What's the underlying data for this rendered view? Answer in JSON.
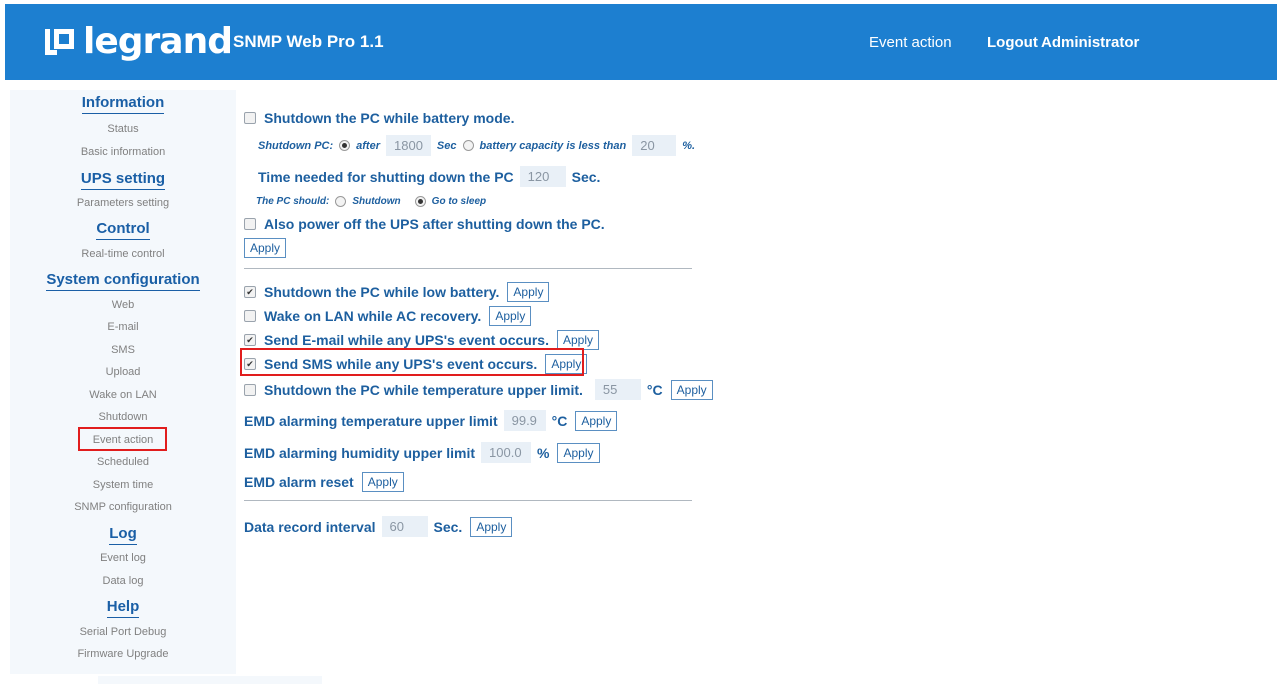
{
  "header": {
    "logo_text": "legrand",
    "app_title": "SNMP Web Pro 1.1",
    "breadcrumb": "Event action",
    "logout_label": "Logout",
    "user_label": "Administrator"
  },
  "sidebar": {
    "sections": [
      {
        "title": "Information",
        "items": [
          "Status",
          "Basic information"
        ]
      },
      {
        "title": "UPS setting",
        "items": [
          "Parameters setting"
        ]
      },
      {
        "title": "Control",
        "items": [
          "Real-time control"
        ]
      },
      {
        "title": "System configuration",
        "items": [
          "Web",
          "E-mail",
          "SMS",
          "Upload",
          "Wake on LAN",
          "Shutdown",
          "Event action",
          "Scheduled",
          "System time",
          "SNMP configuration"
        ]
      },
      {
        "title": "Log",
        "items": [
          "Event log",
          "Data log"
        ]
      },
      {
        "title": "Help",
        "items": [
          "Serial Port Debug",
          "Firmware Upgrade"
        ]
      }
    ],
    "active_item": "Event action"
  },
  "main": {
    "battery_mode": {
      "label": "Shutdown the PC while battery mode.",
      "checked": false,
      "shutdown_pc_label": "Shutdown PC:",
      "after_label": "after",
      "after_value": "1800",
      "sec_label": "Sec",
      "capacity_label": "battery capacity is less than",
      "capacity_value": "20",
      "percent_label": "%.",
      "time_needed_label": "Time needed for shutting down the PC",
      "time_needed_value": "120",
      "time_needed_unit": "Sec.",
      "pc_should_label": "The PC should:",
      "shutdown_option": "Shutdown",
      "sleep_option": "Go to sleep",
      "power_off_label": "Also power off the UPS after shutting down the PC.",
      "power_off_checked": false,
      "apply_label": "Apply"
    },
    "low_battery": {
      "label": "Shutdown the PC while low battery.",
      "checked": true,
      "apply_label": "Apply"
    },
    "wake_on_lan": {
      "label": "Wake on LAN while AC recovery.",
      "checked": false,
      "apply_label": "Apply"
    },
    "send_email": {
      "label": "Send E-mail while any UPS's event occurs.",
      "checked": true,
      "apply_label": "Apply"
    },
    "send_sms": {
      "label": "Send SMS while any UPS's event occurs.",
      "checked": true,
      "apply_label": "Apply"
    },
    "temp_upper": {
      "label": "Shutdown the PC while temperature upper limit.",
      "checked": false,
      "value": "55",
      "unit": "°C",
      "apply_label": "Apply"
    },
    "emd_temp": {
      "label": "EMD alarming temperature upper limit",
      "value": "99.9",
      "unit": "°C",
      "apply_label": "Apply"
    },
    "emd_humidity": {
      "label": "EMD alarming humidity upper limit",
      "value": "100.0",
      "unit": "%",
      "apply_label": "Apply"
    },
    "emd_reset": {
      "label": "EMD alarm reset",
      "apply_label": "Apply"
    },
    "data_record": {
      "label": "Data record interval",
      "value": "60",
      "unit": "Sec.",
      "apply_label": "Apply"
    }
  },
  "colors": {
    "header_bg": "#1d7fd0",
    "text_blue": "#1d5f9f",
    "highlight_red": "#e11d1d",
    "sidebar_bg": "#f4f8fc"
  }
}
